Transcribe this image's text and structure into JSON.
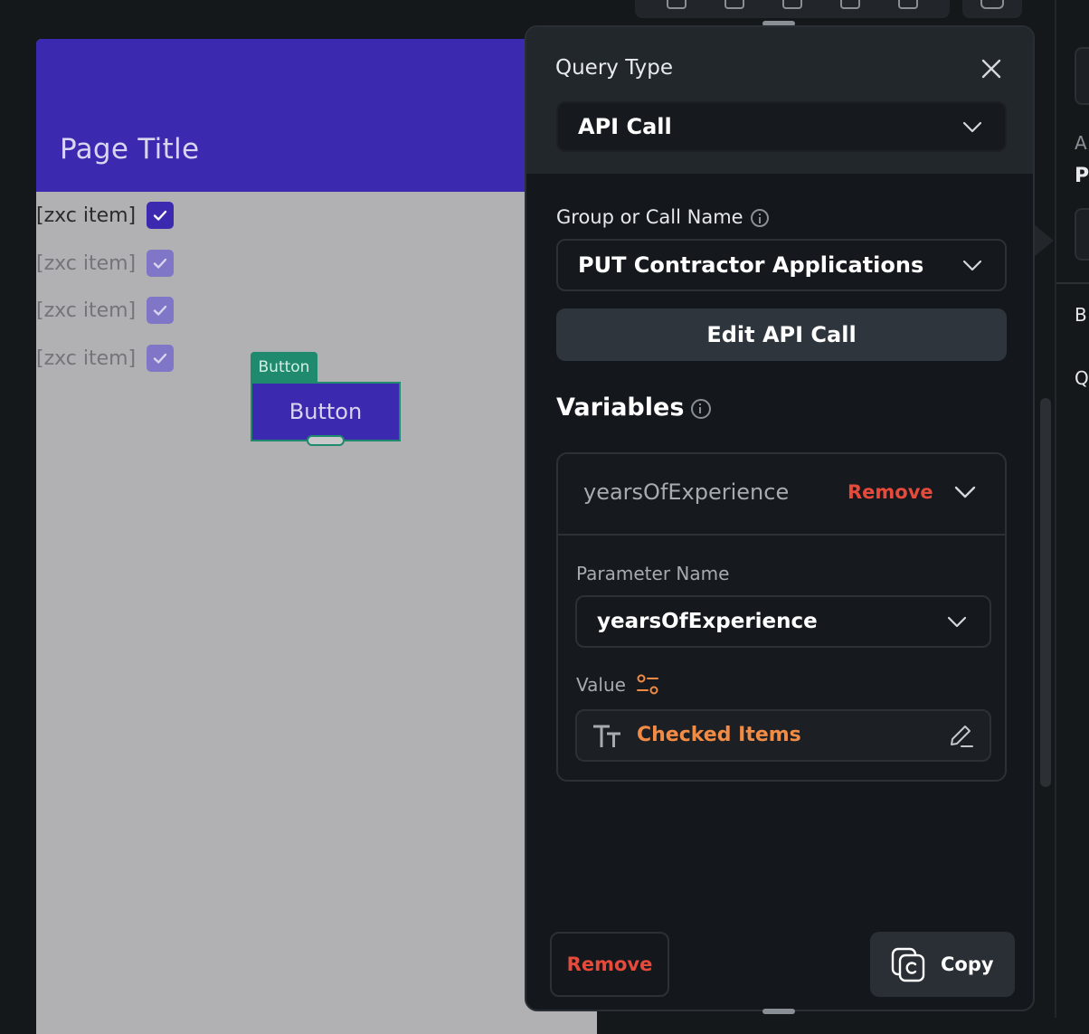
{
  "preview": {
    "page_title": "Page Title",
    "list_items": [
      {
        "label": "[zxc item]",
        "checked": true
      },
      {
        "label": "[zxc item]",
        "checked": true
      },
      {
        "label": "[zxc item]",
        "checked": true
      },
      {
        "label": "[zxc item]",
        "checked": true
      }
    ],
    "button_tag": "Button",
    "button_label": "Button"
  },
  "popover": {
    "query_type_label": "Query Type",
    "query_type_value": "API Call",
    "group_call_label": "Group or Call Name",
    "group_call_value": "PUT Contractor Applications",
    "edit_button": "Edit API Call",
    "variables_label": "Variables",
    "variable": {
      "name": "yearsOfExperience",
      "remove_label": "Remove",
      "parameter_name_label": "Parameter Name",
      "parameter_name_value": "yearsOfExperience",
      "value_label": "Value",
      "value_text": "Checked Items"
    },
    "footer": {
      "remove_label": "Remove",
      "copy_label": "Copy"
    }
  },
  "colors": {
    "brand": "#3b29b0",
    "danger": "#e64a3b",
    "value_accent": "#f28b44",
    "tag_green": "#1f8a6e"
  },
  "icons": [
    "close-icon",
    "chevron-down-icon",
    "info-icon",
    "variable-settings-icon",
    "text-type-icon",
    "pencil-icon",
    "copy-icon",
    "checkmark-icon"
  ]
}
